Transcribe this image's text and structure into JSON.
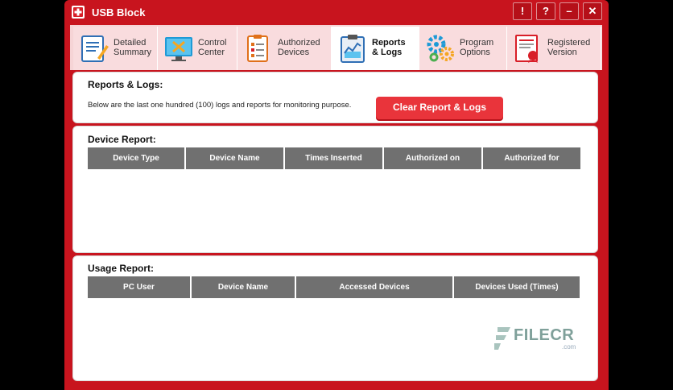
{
  "window": {
    "title": "USB Block",
    "controls": {
      "help_exclaim": "!",
      "help": "?",
      "minimize": "–",
      "close": "✕"
    }
  },
  "tabs": [
    {
      "label": "Detailed\nSummary",
      "icon": "summary-icon",
      "active": false
    },
    {
      "label": "Control\nCenter",
      "icon": "control-center-icon",
      "active": false
    },
    {
      "label": "Authorized\nDevices",
      "icon": "authorized-devices-icon",
      "active": false
    },
    {
      "label": "Reports\n& Logs",
      "icon": "reports-logs-icon",
      "active": true
    },
    {
      "label": "Program\nOptions",
      "icon": "program-options-icon",
      "active": false
    },
    {
      "label": "Registered\nVersion",
      "icon": "registered-version-icon",
      "active": false
    }
  ],
  "reports": {
    "title": "Reports & Logs:",
    "description": "Below are the last one hundred (100) logs and reports for monitoring purpose.",
    "clear_button": "Clear Report & Logs"
  },
  "device_report": {
    "title": "Device Report:",
    "columns": [
      "Device Type",
      "Device Name",
      "Times Inserted",
      "Authorized on",
      "Authorized for"
    ],
    "rows": []
  },
  "usage_report": {
    "title": "Usage Report:",
    "columns": [
      "PC User",
      "Device Name",
      "Accessed Devices",
      "Devices Used (Times)"
    ],
    "rows": []
  },
  "watermark": {
    "text": "FILECR",
    "sub": ".com"
  },
  "colors": {
    "frame": "#c8141e",
    "tab_bg": "#f9dcde",
    "button": "#e9343b",
    "header": "#707070"
  }
}
